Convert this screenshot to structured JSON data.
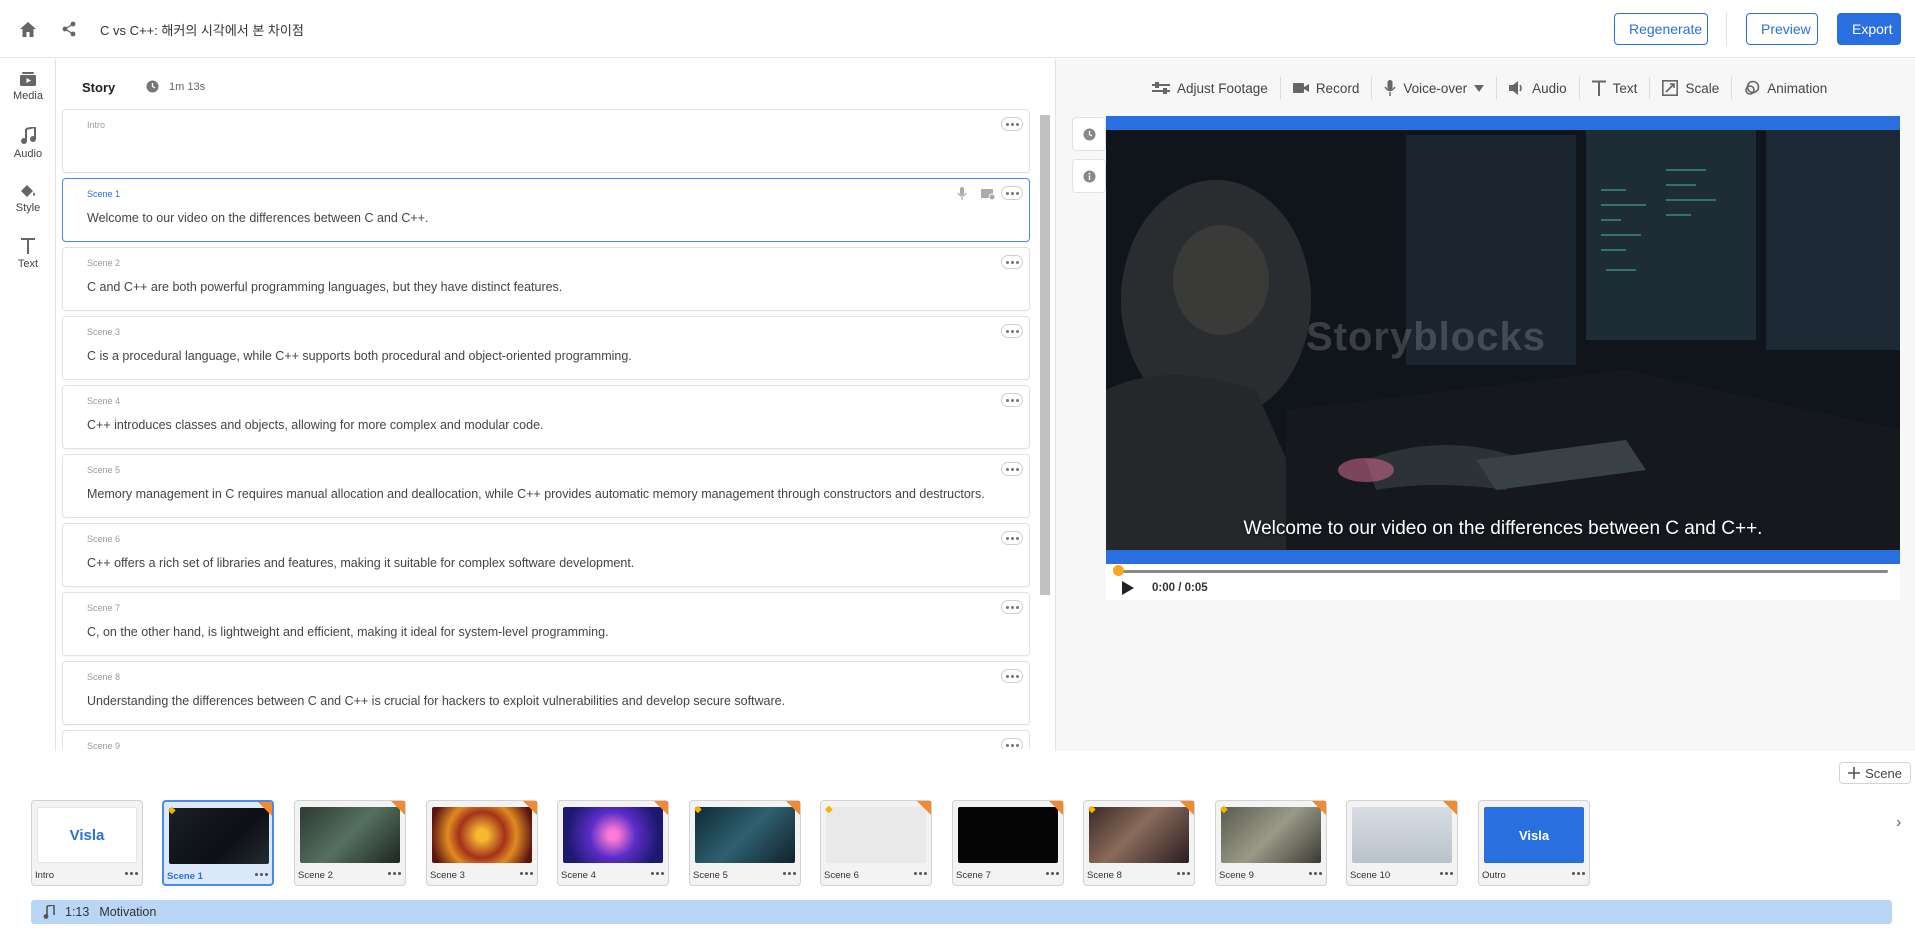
{
  "header": {
    "title": "C vs C++: 해커의 시각에서 본 차이점",
    "regenerate_label": "Regenerate",
    "preview_label": "Preview",
    "export_label": "Export"
  },
  "rail": [
    {
      "label": "Media",
      "icon": "media-icon"
    },
    {
      "label": "Audio",
      "icon": "music-note-icon"
    },
    {
      "label": "Style",
      "icon": "paint-bucket-icon"
    },
    {
      "label": "Text",
      "icon": "text-icon"
    }
  ],
  "story": {
    "title": "Story",
    "duration": "1m 13s",
    "scenes": [
      {
        "label": "Intro",
        "text": ""
      },
      {
        "label": "Scene 1",
        "text": "Welcome to our video on the differences between C and C++."
      },
      {
        "label": "Scene 2",
        "text": "C and C++ are both powerful programming languages, but they have distinct features."
      },
      {
        "label": "Scene 3",
        "text": "C is a procedural language, while C++ supports both procedural and object-oriented programming."
      },
      {
        "label": "Scene 4",
        "text": "C++ introduces classes and objects, allowing for more complex and modular code."
      },
      {
        "label": "Scene 5",
        "text": "Memory management in C requires manual allocation and deallocation, while C++ provides automatic memory management through constructors and destructors."
      },
      {
        "label": "Scene 6",
        "text": "C++ offers a rich set of libraries and features, making it suitable for complex software development."
      },
      {
        "label": "Scene 7",
        "text": "C, on the other hand, is lightweight and efficient, making it ideal for system-level programming."
      },
      {
        "label": "Scene 8",
        "text": "Understanding the differences between C and C++ is crucial for hackers to exploit vulnerabilities and develop secure software."
      },
      {
        "label": "Scene 9",
        "text": ""
      }
    ]
  },
  "toolbar": {
    "adjust_footage": "Adjust Footage",
    "record": "Record",
    "voice_over": "Voice-over",
    "audio": "Audio",
    "text": "Text",
    "scale": "Scale",
    "animation": "Animation"
  },
  "player": {
    "caption": "Welcome to our video on the differences between C and C++.",
    "watermark": "Storyblocks",
    "time": "0:00 / 0:05",
    "progress": 0.0
  },
  "timeline": {
    "add_scene_label": "Scene",
    "thumbs": [
      {
        "label": "Intro",
        "logo": "Visla"
      },
      {
        "label": "Scene 1"
      },
      {
        "label": "Scene 2"
      },
      {
        "label": "Scene 3"
      },
      {
        "label": "Scene 4"
      },
      {
        "label": "Scene 5"
      },
      {
        "label": "Scene 6"
      },
      {
        "label": "Scene 7"
      },
      {
        "label": "Scene 8"
      },
      {
        "label": "Scene 9"
      },
      {
        "label": "Scene 10"
      },
      {
        "label": "Outro",
        "logo": "Visla"
      }
    ],
    "music": {
      "duration": "1:13",
      "name": "Motivation"
    }
  },
  "colors": {
    "accent": "#2a6fe0",
    "music_bar": "#b9d6f6",
    "badge": "#f08a33"
  }
}
